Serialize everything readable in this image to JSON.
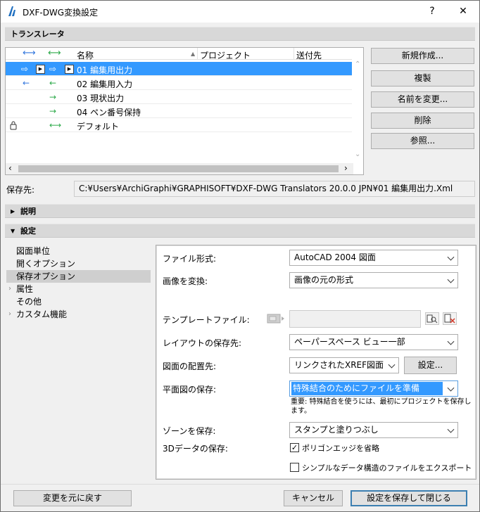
{
  "window": {
    "title": "DXF-DWG変換設定",
    "help": "?",
    "close": "✕"
  },
  "translator_band": "トランスレータ",
  "grid": {
    "headers": {
      "name": "名称",
      "project": "プロジェクト",
      "dest": "送付先"
    },
    "rows": [
      {
        "name": "01 編集用出力",
        "selected": true
      },
      {
        "name": "02 編集用入力"
      },
      {
        "name": "03 現状出力"
      },
      {
        "name": "04 ペン番号保持"
      },
      {
        "name": "デフォルト"
      }
    ]
  },
  "side_buttons": {
    "new": "新規作成...",
    "dup": "複製",
    "rename": "名前を変更...",
    "delete": "削除",
    "browse": "参照..."
  },
  "save_location": {
    "label": "保存先:",
    "path": "C:¥Users¥ArchiGraphi¥GRAPHISOFT¥DXF-DWG Translators 20.0.0 JPN¥01 編集用出力.Xml"
  },
  "desc_band": "説明",
  "settings_band": "設定",
  "tree": [
    {
      "label": "図面単位"
    },
    {
      "label": "開くオプション"
    },
    {
      "label": "保存オプション",
      "selected": true
    },
    {
      "label": "属性",
      "expandable": true
    },
    {
      "label": "その他"
    },
    {
      "label": "カスタム機能",
      "expandable": true
    }
  ],
  "form": {
    "file_format": {
      "label": "ファイル形式:",
      "value": "AutoCAD 2004 図面"
    },
    "image_convert": {
      "label": "画像を変換:",
      "value": "画像の元の形式"
    },
    "template": {
      "label": "テンプレートファイル:",
      "value": ""
    },
    "layout_dest": {
      "label": "レイアウトの保存先:",
      "value": "ペーパースペース ビュー一部"
    },
    "drawing_place": {
      "label": "図面の配置先:",
      "value": "リンクされたXREF図面",
      "button": "設定..."
    },
    "plan_save": {
      "label": "平面図の保存:",
      "value": "特殊結合のためにファイルを準備",
      "note": "重要: 特殊結合を使うには、最初にプロジェクトを保存します。"
    },
    "zone_save": {
      "label": "ゾーンを保存:",
      "value": "スタンプと塗りつぶし"
    },
    "data3d": {
      "label": "3Dデータの保存:",
      "opt1": "ポリゴンエッジを省略",
      "opt1_checked": true,
      "opt2": "シンプルなデータ構造のファイルをエクスポート",
      "opt2_checked": false
    }
  },
  "footer": {
    "revert": "変更を元に戻す",
    "cancel": "キャンセル",
    "save_close": "設定を保存して閉じる"
  }
}
